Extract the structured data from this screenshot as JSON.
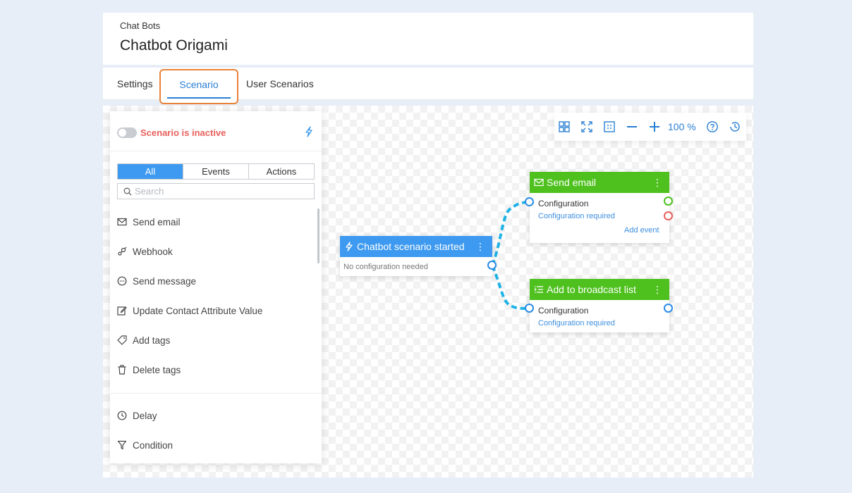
{
  "header": {
    "breadcrumb": "Chat Bots",
    "title": "Chatbot Origami"
  },
  "tabs": [
    {
      "label": "Settings"
    },
    {
      "label": "Scenario",
      "active": true
    },
    {
      "label": "User Scenarios"
    }
  ],
  "panel": {
    "status": "Scenario is inactive",
    "filters": [
      "All",
      "Events",
      "Actions"
    ],
    "active_filter": "All",
    "search_placeholder": "Search",
    "items": [
      {
        "label": "Send email",
        "icon": "mail-icon"
      },
      {
        "label": "Webhook",
        "icon": "webhook-icon"
      },
      {
        "label": "Send message",
        "icon": "message-icon"
      },
      {
        "label": "Update Contact Attribute Value",
        "icon": "edit-icon"
      },
      {
        "label": "Add tags",
        "icon": "tag-icon"
      },
      {
        "label": "Delete tags",
        "icon": "trash-icon"
      }
    ],
    "items_bottom": [
      {
        "label": "Delay",
        "icon": "clock-icon"
      },
      {
        "label": "Condition",
        "icon": "filter-icon"
      }
    ]
  },
  "toolbar": {
    "zoom": "100 %"
  },
  "nodes": {
    "start": {
      "title": "Chatbot scenario started",
      "subtitle": "No configuration needed"
    },
    "email": {
      "title": "Send email",
      "config": "Configuration",
      "required": "Configuration required",
      "add_event": "Add event"
    },
    "broadcast": {
      "title": "Add to broadcast list",
      "config": "Configuration",
      "required": "Configuration required"
    }
  },
  "colors": {
    "accent": "#3d9af0",
    "green": "#4fc11f",
    "inactive": "#e8605c",
    "highlight": "#e8823a"
  }
}
